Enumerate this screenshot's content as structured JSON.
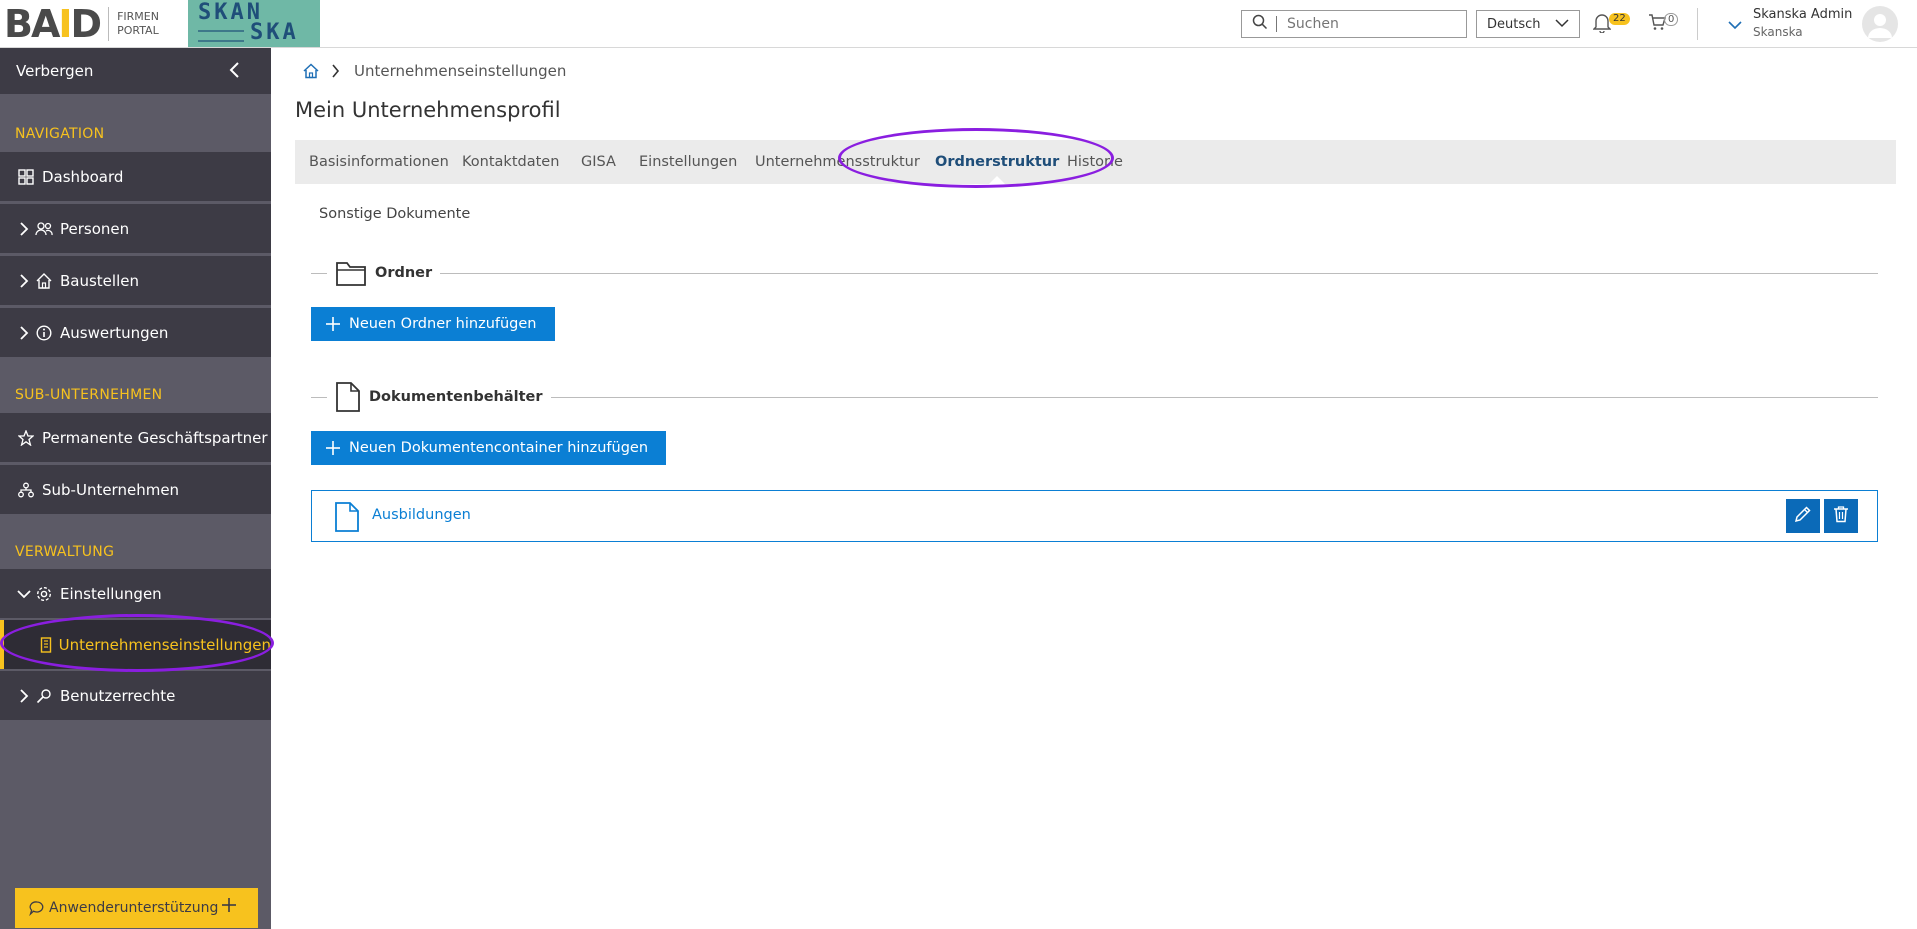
{
  "header": {
    "logo_baid": "BAID",
    "logo_baid_left": "BA",
    "logo_baid_mark": "I",
    "logo_baid_right": "D",
    "logo_firmen": "FIRMEN",
    "logo_portal": "PORTAL",
    "logo_skanska_1": "SKAN",
    "logo_skanska_2": "SKA",
    "search_placeholder": "Suchen",
    "language": "Deutsch",
    "notifications_count": "22",
    "cart_count": "0",
    "user_name": "Skanska Admin",
    "user_org": "Skanska"
  },
  "sidebar": {
    "hide_label": "Verbergen",
    "sections": {
      "navigation": "NAVIGATION",
      "sub_companies": "SUB-UNTERNEHMEN",
      "administration": "VERWALTUNG"
    },
    "items": [
      {
        "label": "Dashboard"
      },
      {
        "label": "Personen"
      },
      {
        "label": "Baustellen"
      },
      {
        "label": "Auswertungen"
      },
      {
        "label": "Permanente Geschäftspartner"
      },
      {
        "label": "Sub-Unternehmen"
      },
      {
        "label": "Einstellungen"
      },
      {
        "label": "Unternehmenseinstellungen"
      },
      {
        "label": "Benutzerrechte"
      }
    ],
    "support_label": "Anwenderunterstützung"
  },
  "main": {
    "breadcrumb_current": "Unternehmenseinstellungen",
    "page_title": "Mein Unternehmensprofil",
    "tabs": [
      {
        "label": "Basisinformationen"
      },
      {
        "label": "Kontaktdaten"
      },
      {
        "label": "GISA"
      },
      {
        "label": "Einstellungen"
      },
      {
        "label": "Unternehmensstruktur"
      },
      {
        "label": "Ordnerstruktur"
      },
      {
        "label": "Historie"
      }
    ],
    "active_tab": "Ordnerstruktur",
    "subtab": "Sonstige Dokumente",
    "folders_group": "Ordner",
    "add_folder_button": "Neuen Ordner hinzufügen",
    "containers_group": "Dokumentenbehälter",
    "add_container_button": "Neuen Dokumentencontainer hinzufügen",
    "documents": [
      {
        "label": "Ausbildungen"
      }
    ]
  },
  "colors": {
    "accent": "#0b7fd4",
    "sidebar_dark": "#3d3b45",
    "sidebar_bg": "#5c5a66",
    "highlight": "#f7c21e",
    "annotation": "#8a1ee0"
  },
  "icons": [
    "home-icon",
    "folder-icon",
    "document-icon",
    "edit-icon",
    "trash-icon",
    "search-icon",
    "bell-icon",
    "cart-icon",
    "dashboard-icon",
    "people-icon",
    "house-icon",
    "info-icon",
    "star-icon",
    "org-icon",
    "gear-icon",
    "building-icon",
    "key-icon",
    "chat-icon"
  ]
}
